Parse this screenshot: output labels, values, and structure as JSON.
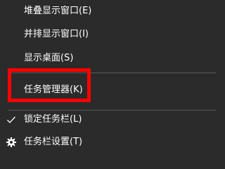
{
  "context_menu": {
    "items": [
      {
        "label": "堆叠显示窗口(E)"
      },
      {
        "label": "并排显示窗口(I)"
      },
      {
        "label": "显示桌面(S)"
      },
      {
        "label": "任务管理器(K)"
      },
      {
        "label": "锁定任务栏(L)",
        "checked": true,
        "icon": "checkmark-icon"
      },
      {
        "label": "任务栏设置(T)",
        "icon": "gear-icon"
      }
    ],
    "highlight_color": "#ff0000",
    "background_color": "#2b2b2b",
    "text_color": "#ffffff"
  }
}
